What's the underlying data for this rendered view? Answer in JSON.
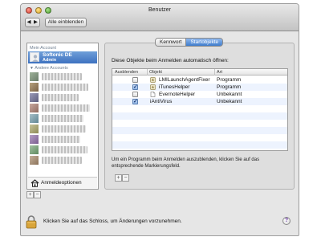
{
  "window": {
    "title": "Benutzer",
    "show_all_label": "Alle einblenden",
    "nav_back": "◀",
    "nav_forward": "▶"
  },
  "accounts": {
    "my_account_header": "Mein Account",
    "selected_name": "Softonic DE",
    "selected_role": "Admin",
    "other_header": "Andere Accounts",
    "other_header_icon": "▼",
    "login_options_label": "Anmeldeoptionen",
    "add_label": "+",
    "remove_label": "−"
  },
  "tabs": [
    {
      "label": "Kennwort",
      "selected": false
    },
    {
      "label": "Startobjekte",
      "selected": true
    }
  ],
  "startup": {
    "intro": "Diese Objekte beim Anmelden automatisch öffnen:",
    "columns": [
      "Ausblenden",
      "Objekt",
      "Art"
    ],
    "items": [
      {
        "hidden": false,
        "name": "LMILaunchAgentFixer",
        "type": "Programm"
      },
      {
        "hidden": true,
        "name": "iTunesHelper",
        "type": "Programm"
      },
      {
        "hidden": false,
        "name": "EvernoteHelper",
        "type": "Unbekannt"
      },
      {
        "hidden": true,
        "name": "iAntiVirus",
        "type": "Unbekannt"
      }
    ],
    "help_text": "Um ein Programm beim Anmelden auszublenden, klicken Sie auf das entsprechende Markierungsfeld.",
    "add_label": "+",
    "remove_label": "−"
  },
  "footer": {
    "lock_text": "Klicken Sie auf das Schloss, um Änderungen vorzunehmen.",
    "help_label": "?"
  },
  "colors": {
    "selection_blue": "#3d71c0",
    "window_bg": "#e6e6e6"
  }
}
